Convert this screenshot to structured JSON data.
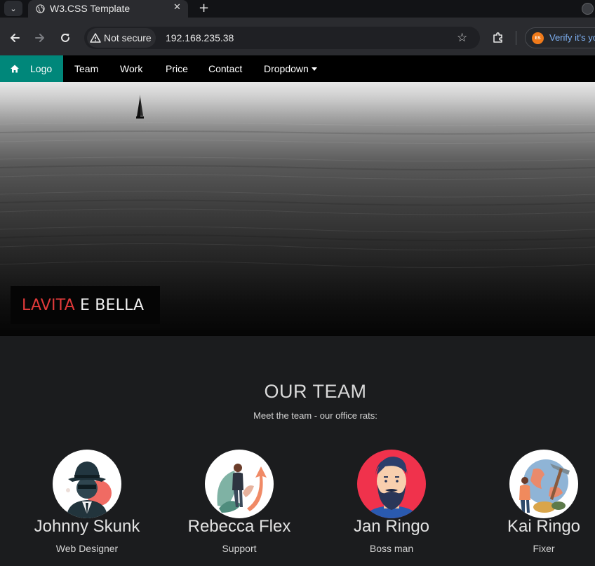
{
  "browser": {
    "tab_title": "W3.CSS Template",
    "security_label": "Not secure",
    "url": "192.168.235.38",
    "verify_label": "Verify it's yo",
    "verify_badge": "ES"
  },
  "nav": {
    "logo_label": "Logo",
    "links": [
      "Team",
      "Work",
      "Price",
      "Contact",
      "Dropdown"
    ],
    "accent_color": "#00877a"
  },
  "hero": {
    "accent": "LAVITA",
    "rest": "E BELLA",
    "accent_color": "#e23a3a"
  },
  "team": {
    "title": "OUR TEAM",
    "subtitle": "Meet the team - our office rats:",
    "members": [
      {
        "name": "Johnny Skunk",
        "role": "Web Designer",
        "icon": "detective-avatar"
      },
      {
        "name": "Rebecca Flex",
        "role": "Support",
        "icon": "growth-chart-avatar"
      },
      {
        "name": "Jan Ringo",
        "role": "Boss man",
        "icon": "bearded-man-avatar"
      },
      {
        "name": "Kai Ringo",
        "role": "Fixer",
        "icon": "builder-globe-avatar"
      }
    ]
  }
}
